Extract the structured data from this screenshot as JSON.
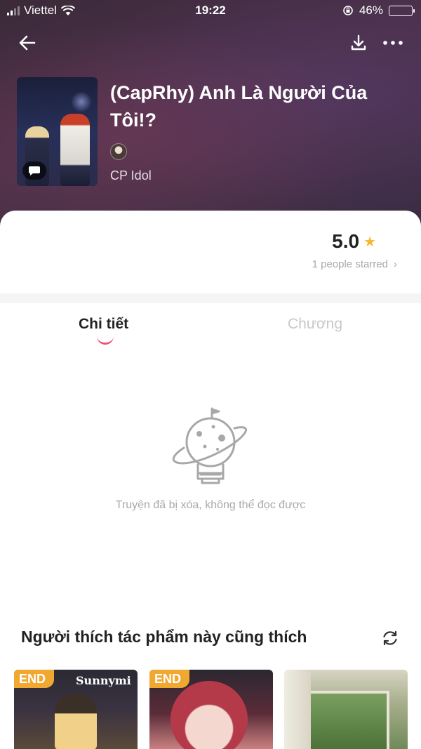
{
  "status_bar": {
    "carrier": "Viettel",
    "time": "19:22",
    "battery_percent": "46%",
    "battery_level": 0.46
  },
  "header": {
    "back_icon": "back-arrow-icon",
    "download_icon": "download-icon",
    "more_icon": "more-dots-icon"
  },
  "book": {
    "title": "(CapRhy) Anh Là Người Của Tôi!?",
    "category": "CP Idol"
  },
  "rating": {
    "score": "5.0",
    "starred_text": "1 people starred",
    "chevron": "›"
  },
  "tabs": [
    {
      "label": "Chi tiết",
      "active": true
    },
    {
      "label": "Chương",
      "active": false
    }
  ],
  "empty_state": {
    "message": "Truyện đã bị xóa, không thể đọc được"
  },
  "recommendations": {
    "title": "Người thích tác phẩm này cũng thích",
    "items": [
      {
        "badge": "END",
        "cover_text": "Sunnymi"
      },
      {
        "badge": "END",
        "cover_text": ""
      },
      {
        "badge": "",
        "cover_text": ""
      }
    ]
  },
  "colors": {
    "accent_pink": "#f0506e",
    "star": "#f5b82e",
    "end_badge": "#f0a830",
    "battery": "#ffcc00"
  }
}
